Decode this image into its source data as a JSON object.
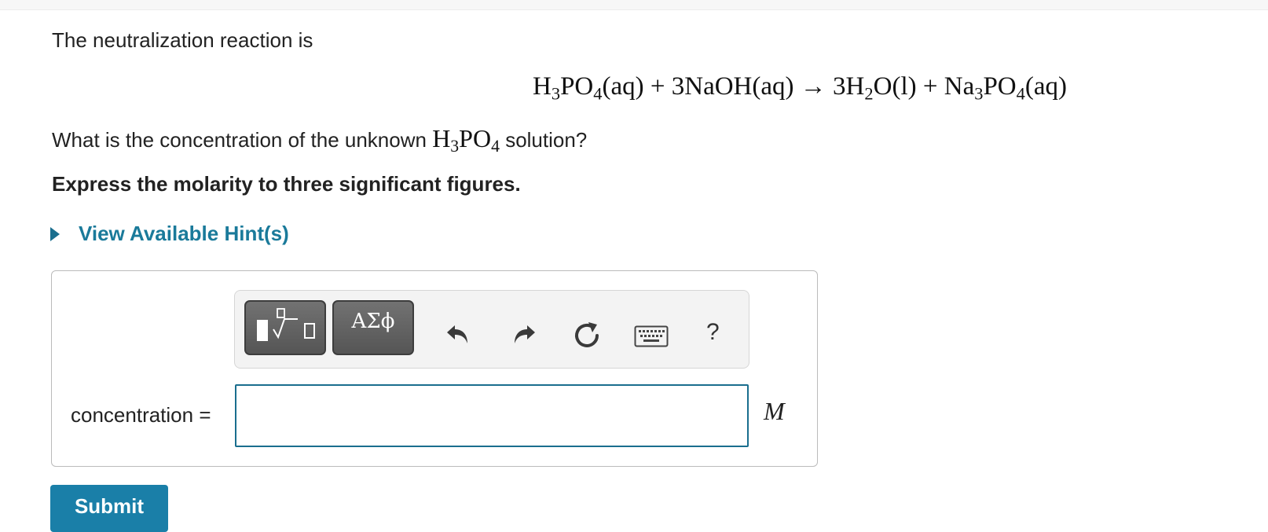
{
  "intro_text": "The neutralization reaction is",
  "equation": {
    "reactant1": {
      "main1": "H",
      "sub1": "3",
      "main2": "PO",
      "sub2": "4",
      "state": "(aq)"
    },
    "plus1": "+",
    "reactant2": {
      "coeff": "3",
      "formula": "NaOH",
      "state": "(aq)"
    },
    "arrow": "→",
    "product1": {
      "coeff": "3",
      "main1": "H",
      "sub1": "2",
      "main2": "O",
      "state": "(l)"
    },
    "plus2": "+",
    "product2": {
      "main1": "Na",
      "sub1": "3",
      "main2": "PO",
      "sub2": "4",
      "state": "(aq)"
    }
  },
  "question": {
    "before": "What is the concentration of the unknown",
    "formula": {
      "main1": "H",
      "sub1": "3",
      "main2": "PO",
      "sub2": "4"
    },
    "after": "solution?"
  },
  "instruction": "Express the molarity to three significant figures.",
  "hint_label": "View Available Hint(s)",
  "toolbar": {
    "templates_icon": "fraction-root-template-icon",
    "symbols_label": "ΑΣϕ",
    "undo_icon": "undo-icon",
    "redo_icon": "redo-icon",
    "reset_icon": "reset-icon",
    "keyboard_icon": "keyboard-icon",
    "help_label": "?"
  },
  "answer": {
    "label": "concentration =",
    "value": "",
    "unit": "M"
  },
  "submit_label": "Submit",
  "colors": {
    "accent": "#1a7fa8",
    "link": "#1a7a9a",
    "input_border": "#1a6e8e",
    "toolbar_button": "#5f5f5f"
  }
}
